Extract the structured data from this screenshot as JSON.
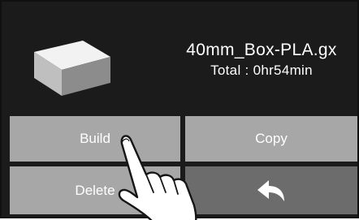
{
  "job": {
    "file_name": "40mm_Box-PLA.gx",
    "total_time": "Total : 0hr54min"
  },
  "buttons": {
    "build_label": "Build",
    "copy_label": "Copy",
    "delete_label": "Delete"
  },
  "icons": {
    "thumbnail": "cube-model-thumbnail",
    "back": "back-arrow-icon",
    "overlay": "pointing-hand-icon"
  },
  "colors": {
    "screen_bg": "#1b1b1b",
    "button_light": "#a7a7a7",
    "button_dark": "#6c6c6c",
    "text": "#ffffff"
  }
}
